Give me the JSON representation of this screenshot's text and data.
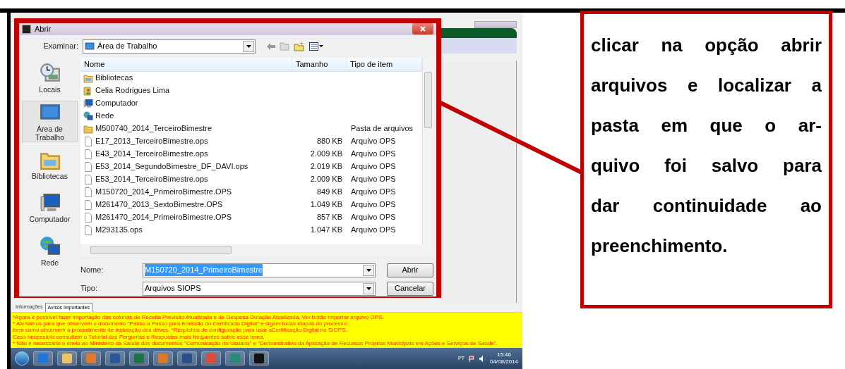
{
  "dialog": {
    "title": "Abrir",
    "look_in_label": "Examinar:",
    "look_in_value": "Área de Trabalho",
    "places": [
      {
        "label": "Locais",
        "kind": "recent",
        "selected": false
      },
      {
        "label": "Área de Trabalho",
        "kind": "desktop",
        "selected": true
      },
      {
        "label": "Bibliotecas",
        "kind": "library",
        "selected": false
      },
      {
        "label": "Computador",
        "kind": "computer",
        "selected": false
      },
      {
        "label": "Rede",
        "kind": "network",
        "selected": false
      }
    ],
    "columns": [
      "Nome",
      "Tamanho",
      "Tipo de item"
    ],
    "files": [
      {
        "name": "Bibliotecas",
        "kind": "library"
      },
      {
        "name": "Celia Rodrigues Lima",
        "kind": "user"
      },
      {
        "name": "Computador",
        "kind": "computer"
      },
      {
        "name": "Rede",
        "kind": "network"
      },
      {
        "name": "M500740_2014_TerceiroBimestre",
        "kind": "folder",
        "type": "Pasta de arquivos"
      },
      {
        "name": "E17_2013_TerceiroBimestre.ops",
        "kind": "file",
        "size": "880 KB",
        "type": "Arquivo OPS"
      },
      {
        "name": "E43_2014_TerceiroBimestre.ops",
        "kind": "file",
        "size": "2.009 KB",
        "type": "Arquivo OPS"
      },
      {
        "name": "E53_2014_SegundoBimestre_DF_DAVI.ops",
        "kind": "file",
        "size": "2.019 KB",
        "type": "Arquivo OPS"
      },
      {
        "name": "E53_2014_TerceiroBimestre.ops",
        "kind": "file",
        "size": "2.009 KB",
        "type": "Arquivo OPS"
      },
      {
        "name": "M150720_2014_PrimeiroBimestre.OPS",
        "kind": "file",
        "size": "849 KB",
        "type": "Arquivo OPS"
      },
      {
        "name": "M261470_2013_SextoBimestre.OPS",
        "kind": "file",
        "size": "1.049 KB",
        "type": "Arquivo OPS"
      },
      {
        "name": "M261470_2014_PrimeiroBimestre.OPS",
        "kind": "file",
        "size": "857 KB",
        "type": "Arquivo OPS"
      },
      {
        "name": "M293135.ops",
        "kind": "file",
        "size": "1.047 KB",
        "type": "Arquivo OPS"
      }
    ],
    "file_name": {
      "label": "Nome:",
      "value": "M150720_2014_PrimeiroBimestre"
    },
    "file_type": {
      "label": "Tipo:",
      "value": "Arquivos SIOPS"
    },
    "buttons": [
      "Abrir",
      "Cancelar"
    ]
  },
  "app_tabs": [
    {
      "label": "Informações",
      "selected": false
    },
    {
      "label": "Avisos Importantes",
      "selected": true
    }
  ],
  "notices": [
    "*Agora é possível fazer importação das colunas de Receita Previsão Atualizada e  de Despesa Dotação Atualizada. Ver botão Importar arquivo OPS.",
    "* Alertamos para que observem o documento \"Passo a Passo para Emissão do Certificado Digital\" e sigam todas etapas do processo:",
    "bem como observem o procedimento de instalação dos drives. *Requisitos de configuração para usar aCertificação Digital no SIOPS.",
    "Caso necessário consultem o Tutorial das Perguntas e Respostas mais frequentes sobre esse tema.",
    "* Não é necessário o envio ao Ministério da Saúde dos documentos \"Comunicação do Usuário\" e \"Demonstrativo da Aplicação de Recursos Próprios Municipais em Ações e Serviços de Saúde\"."
  ],
  "taskbar": {
    "language": "PT",
    "time": "15:46",
    "date": "04/08/2014"
  },
  "callout": {
    "lines": [
      "clicar na opção abrir",
      "arquivos e localizar a",
      "pasta em que o ar-",
      "quivo foi salvo para",
      "dar continuidade ao",
      "preenchimento."
    ]
  }
}
